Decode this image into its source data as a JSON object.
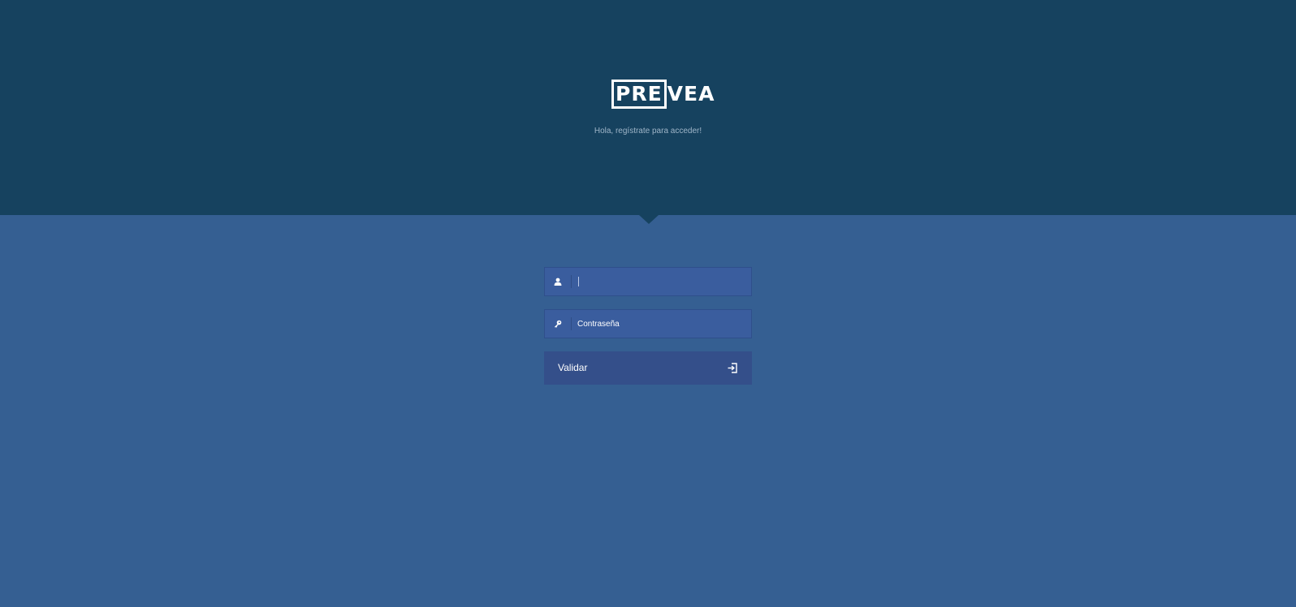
{
  "header": {
    "logo": {
      "boxed_text": "PRE",
      "rest_text": "VEA"
    },
    "subtitle": "Hola, regístrate para acceder!"
  },
  "login_form": {
    "username": {
      "icon": "user-icon",
      "value": "",
      "placeholder": ""
    },
    "password": {
      "icon": "key-icon",
      "value": "",
      "placeholder": "Contraseña"
    },
    "submit": {
      "label": "Validar",
      "icon": "sign-in-icon"
    }
  },
  "colors": {
    "header_bg": "#16425f",
    "page_bg": "#355f92",
    "input_bg": "#3a5d9e",
    "button_bg": "#344f8a"
  }
}
